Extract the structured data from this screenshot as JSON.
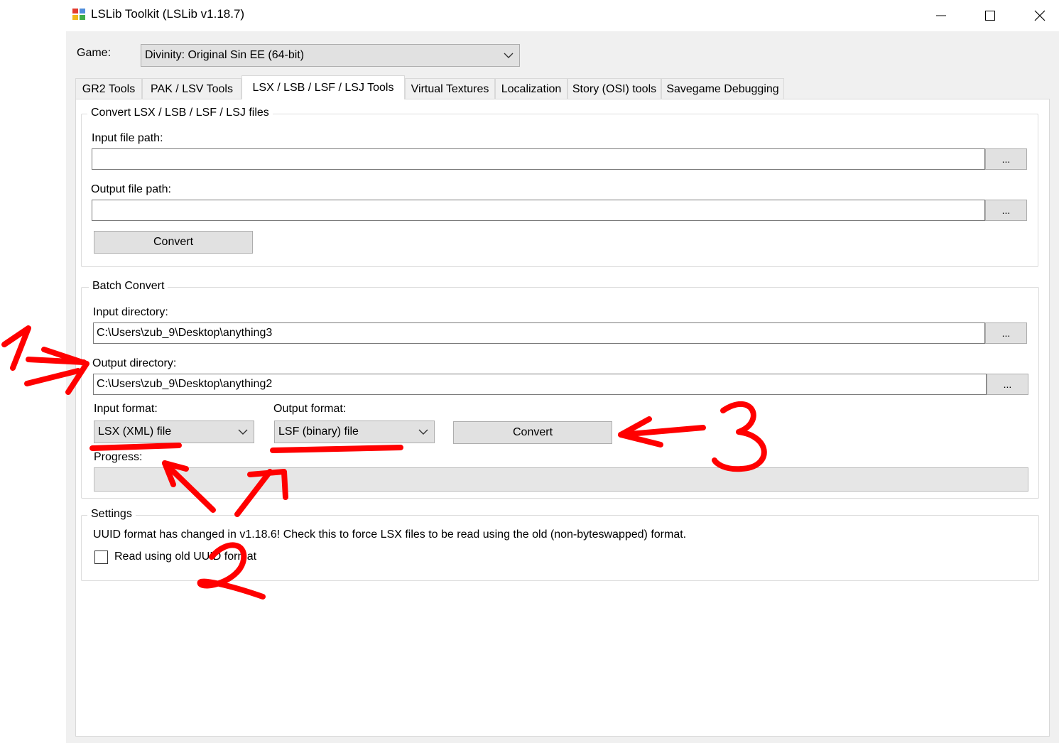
{
  "window": {
    "title": "LSLib Toolkit (LSLib v1.18.7)",
    "controls": {
      "minimize": "minimize-icon",
      "maximize": "maximize-icon",
      "close": "close-icon"
    }
  },
  "game": {
    "label": "Game:",
    "selected": "Divinity: Original Sin EE (64-bit)"
  },
  "tabs": [
    {
      "label": "GR2 Tools",
      "active": false
    },
    {
      "label": "PAK / LSV Tools",
      "active": false
    },
    {
      "label": "LSX / LSB / LSF / LSJ Tools",
      "active": true
    },
    {
      "label": "Virtual Textures",
      "active": false
    },
    {
      "label": "Localization",
      "active": false
    },
    {
      "label": "Story (OSI) tools",
      "active": false
    },
    {
      "label": "Savegame Debugging",
      "active": false
    }
  ],
  "convert_group": {
    "title": "Convert LSX / LSB / LSF / LSJ files",
    "input_label": "Input file path:",
    "input_value": "",
    "output_label": "Output file path:",
    "output_value": "",
    "browse_label": "...",
    "convert_label": "Convert"
  },
  "batch_group": {
    "title": "Batch Convert",
    "input_dir_label": "Input directory:",
    "input_dir_value": "C:\\Users\\zub_9\\Desktop\\anything3",
    "output_dir_label": "Output directory:",
    "output_dir_value": "C:\\Users\\zub_9\\Desktop\\anything2",
    "browse_label": "...",
    "input_format_label": "Input format:",
    "input_format_selected": "LSX (XML) file",
    "output_format_label": "Output format:",
    "output_format_selected": "LSF (binary) file",
    "convert_label": "Convert",
    "progress_label": "Progress:",
    "progress_value": 0
  },
  "settings_group": {
    "title": "Settings",
    "note": "UUID format has changed in v1.18.6! Check this to force LSX files to be read using the old (non-byteswapped) format.",
    "checkbox_label": "Read using old UUID format",
    "checkbox_checked": false
  },
  "annotations": {
    "color": "#ff0000",
    "labels": [
      "1",
      "2",
      "3"
    ]
  },
  "colors": {
    "window_bg": "#f0f0f0",
    "button_bg": "#e1e1e1",
    "annotation": "#ff0000"
  }
}
